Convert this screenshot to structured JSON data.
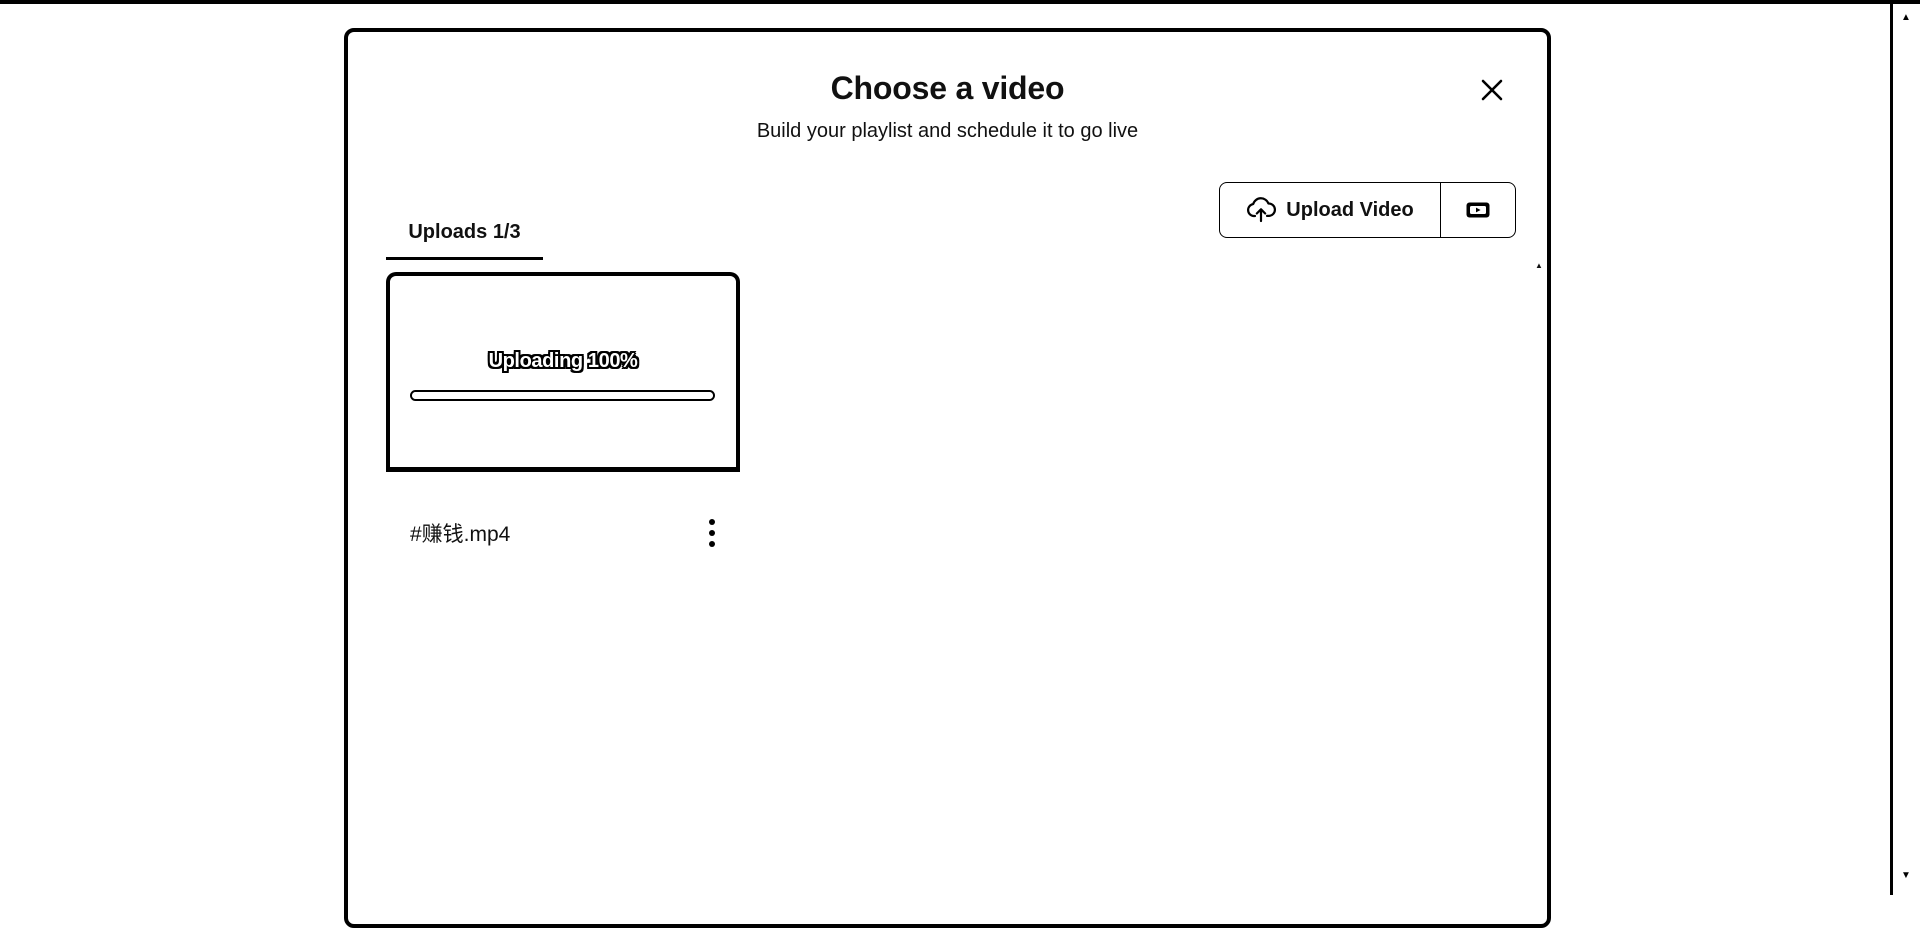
{
  "modal": {
    "title": "Choose a video",
    "subtitle": "Build your playlist and schedule it to go live"
  },
  "tabs": [
    {
      "label": "Uploads 1/3",
      "active": true
    }
  ],
  "toolbar": {
    "upload_label": "Upload Video",
    "upload_icon": "cloud-upload-icon",
    "record_icon": "screen-record-icon",
    "close_icon": "close-icon"
  },
  "videos": [
    {
      "status_text": "Uploading 100%",
      "progress": 1.0,
      "file_name": "#赚钱.mp4",
      "menu_icon": "more-vertical-icon"
    }
  ],
  "colors": {
    "border": "#000000",
    "background": "#ffffff",
    "text": "#111111"
  }
}
